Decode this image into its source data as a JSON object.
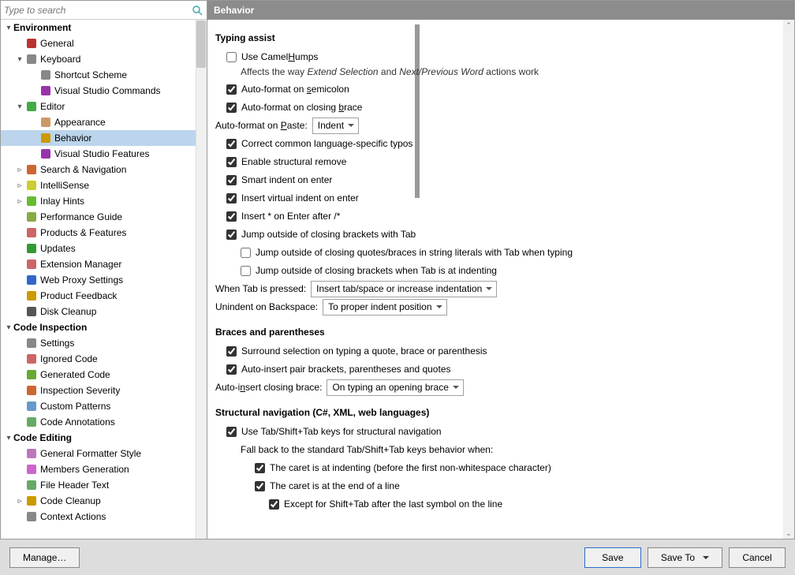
{
  "search": {
    "placeholder": "Type to search"
  },
  "header": "Behavior",
  "tree": [
    {
      "d": 1,
      "arrow": "▾",
      "label": "Environment",
      "bold": true,
      "icon": "none"
    },
    {
      "d": 2,
      "arrow": "",
      "label": "General",
      "icon": "rs"
    },
    {
      "d": 2,
      "arrow": "▾",
      "label": "Keyboard",
      "icon": "keyboard"
    },
    {
      "d": 3,
      "arrow": "",
      "label": "Shortcut Scheme",
      "icon": "keyboard"
    },
    {
      "d": 3,
      "arrow": "",
      "label": "Visual Studio Commands",
      "icon": "vs"
    },
    {
      "d": 2,
      "arrow": "▾",
      "label": "Editor",
      "icon": "pencil"
    },
    {
      "d": 3,
      "arrow": "",
      "label": "Appearance",
      "icon": "palette"
    },
    {
      "d": 3,
      "arrow": "",
      "label": "Behavior",
      "icon": "gear",
      "selected": true
    },
    {
      "d": 3,
      "arrow": "",
      "label": "Visual Studio Features",
      "icon": "vs"
    },
    {
      "d": 2,
      "arrow": "▹",
      "label": "Search & Navigation",
      "icon": "search"
    },
    {
      "d": 2,
      "arrow": "▹",
      "label": "IntelliSense",
      "icon": "bulb"
    },
    {
      "d": 2,
      "arrow": "▹",
      "label": "Inlay Hints",
      "icon": "hint"
    },
    {
      "d": 2,
      "arrow": "",
      "label": "Performance Guide",
      "icon": "snail"
    },
    {
      "d": 2,
      "arrow": "",
      "label": "Products & Features",
      "icon": "box"
    },
    {
      "d": 2,
      "arrow": "",
      "label": "Updates",
      "icon": "update"
    },
    {
      "d": 2,
      "arrow": "",
      "label": "Extension Manager",
      "icon": "ext"
    },
    {
      "d": 2,
      "arrow": "",
      "label": "Web Proxy Settings",
      "icon": "globe"
    },
    {
      "d": 2,
      "arrow": "",
      "label": "Product Feedback",
      "icon": "mail"
    },
    {
      "d": 2,
      "arrow": "",
      "label": "Disk Cleanup",
      "icon": "disk"
    },
    {
      "d": 1,
      "arrow": "▾",
      "label": "Code Inspection",
      "bold": true,
      "icon": "none"
    },
    {
      "d": 2,
      "arrow": "",
      "label": "Settings",
      "icon": "wrench"
    },
    {
      "d": 2,
      "arrow": "",
      "label": "Ignored Code",
      "icon": "ignore"
    },
    {
      "d": 2,
      "arrow": "",
      "label": "Generated Code",
      "icon": "gen"
    },
    {
      "d": 2,
      "arrow": "",
      "label": "Inspection Severity",
      "icon": "severity"
    },
    {
      "d": 2,
      "arrow": "",
      "label": "Custom Patterns",
      "icon": "pattern"
    },
    {
      "d": 2,
      "arrow": "",
      "label": "Code Annotations",
      "icon": "annot"
    },
    {
      "d": 1,
      "arrow": "▾",
      "label": "Code Editing",
      "bold": true,
      "icon": "none"
    },
    {
      "d": 2,
      "arrow": "",
      "label": "General Formatter Style",
      "icon": "format"
    },
    {
      "d": 2,
      "arrow": "",
      "label": "Members Generation",
      "icon": "members"
    },
    {
      "d": 2,
      "arrow": "",
      "label": "File Header Text",
      "icon": "file"
    },
    {
      "d": 2,
      "arrow": "▹",
      "label": "Code Cleanup",
      "icon": "cleanup"
    },
    {
      "d": 2,
      "arrow": "",
      "label": "Context Actions",
      "icon": "context"
    }
  ],
  "sections": {
    "typing_assist": {
      "title": "Typing assist",
      "camelhumps": {
        "checked": false,
        "pre": "Use Camel",
        "u": "H",
        "post": "umps"
      },
      "camel_note_pre": "Affects the way ",
      "camel_note_i1": "Extend Selection",
      "camel_note_mid": " and ",
      "camel_note_i2": "Next/Previous Word",
      "camel_note_post": " actions work",
      "semicolon": {
        "checked": true,
        "pre": "Auto-format on ",
        "u": "s",
        "post": "emicolon"
      },
      "brace": {
        "checked": true,
        "pre": "Auto-format on closing ",
        "u": "b",
        "post": "race"
      },
      "paste_label_pre": "Auto-format on ",
      "paste_label_u": "P",
      "paste_label_post": "aste:",
      "paste_value": "Indent",
      "typos": {
        "checked": true,
        "label": "Correct common language-specific typos"
      },
      "structural": {
        "checked": true,
        "label": "Enable structural remove"
      },
      "smart_indent": {
        "checked": true,
        "label": "Smart indent on enter"
      },
      "virtual_indent": {
        "checked": true,
        "label": "Insert virtual indent on enter"
      },
      "insert_star": {
        "checked": true,
        "label": "Insert * on Enter after /*"
      },
      "jump_tab": {
        "checked": true,
        "label": "Jump outside of closing brackets with Tab"
      },
      "jump_quotes": {
        "checked": false,
        "label": "Jump outside of closing quotes/braces in string literals with Tab when typing"
      },
      "jump_indent": {
        "checked": false,
        "label": "Jump outside of closing brackets when Tab is at indenting"
      },
      "tab_label": "When Tab is pressed:",
      "tab_value": "Insert tab/space or increase indentation",
      "unindent_label": "Unindent on Backspace:",
      "unindent_value": "To proper indent position"
    },
    "braces": {
      "title": "Braces and parentheses",
      "surround": {
        "checked": true,
        "label": "Surround selection on typing a quote, brace or parenthesis"
      },
      "autoinsert": {
        "checked": true,
        "label": "Auto-insert pair brackets, parentheses and quotes"
      },
      "closing_pre": "Auto-i",
      "closing_u": "n",
      "closing_post": "sert closing brace:",
      "closing_value": "On typing an opening brace"
    },
    "structural": {
      "title": "Structural navigation (C#, XML, web languages)",
      "use_tab": {
        "checked": true,
        "label": "Use Tab/Shift+Tab keys for structural navigation"
      },
      "fallback": "Fall back to the standard Tab/Shift+Tab keys behavior when:",
      "caret_indent": {
        "checked": true,
        "label": "The caret is at indenting (before the first non-whitespace character)"
      },
      "caret_end": {
        "checked": true,
        "label": "The caret is at the end of a line"
      },
      "except": {
        "checked": true,
        "label": "Except for Shift+Tab after the last symbol on the line"
      }
    }
  },
  "footer": {
    "manage": "Manage…",
    "save": "Save",
    "saveto": "Save To",
    "cancel": "Cancel"
  }
}
